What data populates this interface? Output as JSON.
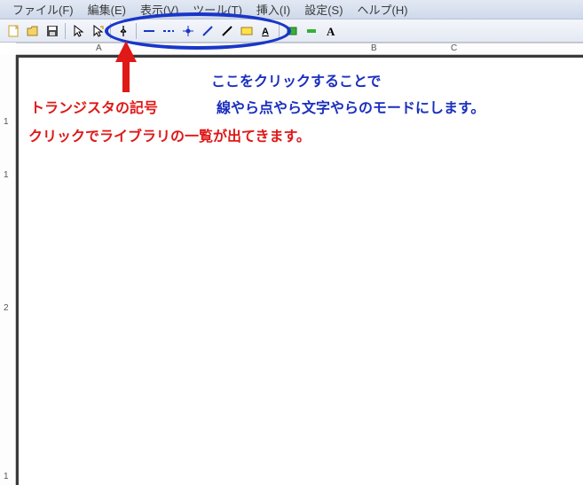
{
  "menu": {
    "file": "ファイル(F)",
    "edit": "編集(E)",
    "view": "表示(V)",
    "tools": "ツール(T)",
    "insert": "挿入(I)",
    "settings": "設定(S)",
    "help": "ヘルプ(H)"
  },
  "ruler": {
    "cols": [
      "A",
      "B",
      "C"
    ],
    "rows": [
      "1",
      "1",
      "2",
      "1"
    ]
  },
  "annotations": {
    "blue1": "ここをクリックすることで",
    "blue2": "線やら点やら文字やらのモードにします。",
    "red1": "トランジスタの記号",
    "red2": "クリックでライブラリの一覧が出てきます。"
  },
  "icons": {
    "new": "new",
    "open": "open",
    "save": "save",
    "cursor": "cursor",
    "move": "move",
    "component": "component",
    "hline": "hline",
    "dash": "dash",
    "point": "point",
    "diag": "diag",
    "diag2": "diag2",
    "rect_y": "rect_y",
    "au": "A",
    "rect_g": "rect_g",
    "minus_g": "minus_g",
    "text": "A"
  }
}
